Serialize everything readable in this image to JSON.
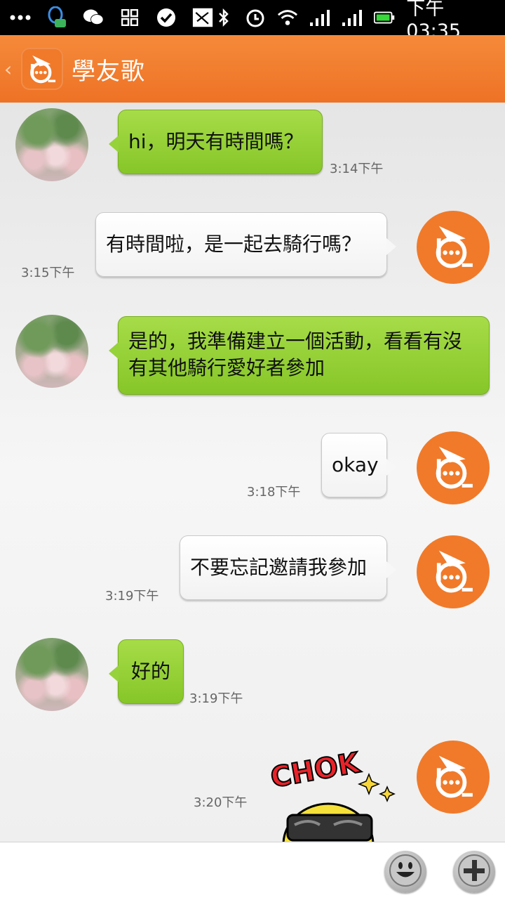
{
  "status_bar": {
    "time": "下午03:35",
    "icons": [
      "more-icon",
      "qq-icon",
      "wechat-icon",
      "apps-icon",
      "check-icon",
      "sms-icon",
      "bluetooth-icon",
      "alarm-icon",
      "wifi-icon",
      "signal-icon",
      "signal-icon",
      "battery-icon"
    ]
  },
  "header": {
    "title": "學友歌",
    "back_glyph": "‹"
  },
  "messages": [
    {
      "side": "left",
      "text": "hi，明天有時間嗎？",
      "time": "3:14下午"
    },
    {
      "side": "right",
      "text": "有時間啦，是一起去騎行嗎？",
      "time": "3:15下午"
    },
    {
      "side": "left",
      "text": "是的，我準備建立一個活動，看看有沒有其他騎行愛好者參加",
      "time": ""
    },
    {
      "side": "right",
      "text": "okay",
      "time": "3:18下午"
    },
    {
      "side": "right",
      "text": "不要忘記邀請我參加",
      "time": "3:19下午"
    },
    {
      "side": "left",
      "text": "好的",
      "time": "3:19下午"
    },
    {
      "side": "right",
      "text": "",
      "time": "3:20下午",
      "sticker_text": "CHOK"
    }
  ],
  "input": {
    "placeholder": "",
    "emoji_button": "emoji-icon",
    "add_button": "plus-icon"
  },
  "colors": {
    "accent": "#ef7a2b",
    "bubble_green": "#98d23a",
    "bubble_white": "#f7f7f7"
  }
}
